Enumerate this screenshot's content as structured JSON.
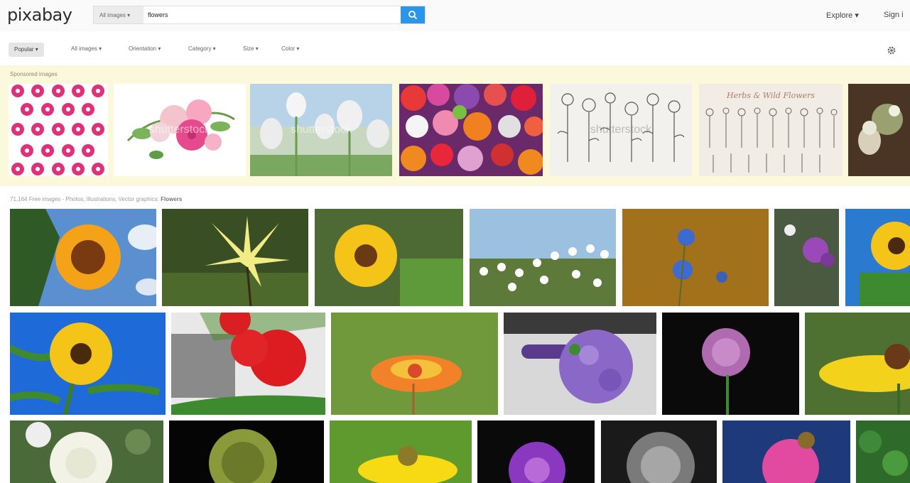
{
  "header": {
    "logo": "pixabay",
    "search_scope": "All images ▾",
    "search_query": "flowers",
    "explore": "Explore ▾",
    "sign_in": "Sign i"
  },
  "filters": [
    {
      "label": "Popular ▾",
      "selected": true
    },
    {
      "label": "All images ▾"
    },
    {
      "label": "Orientation ▾"
    },
    {
      "label": "Category ▾"
    },
    {
      "label": "Size ▾"
    },
    {
      "label": "Color ▾"
    }
  ],
  "sponsored": {
    "label": "Sponsored images",
    "watermark": "shutterstock",
    "collection_title": "Herbs & Wild Flowers"
  },
  "results": {
    "label_prefix": "71,164 Free images - Photos, Illustrations, Vector graphics:",
    "label_query": "Flowers"
  },
  "icons": {
    "search": "search-icon",
    "settings": "gear-icon"
  },
  "colors": {
    "accent": "#2b95e9",
    "sponsored_bg": "#fcf8dc"
  }
}
